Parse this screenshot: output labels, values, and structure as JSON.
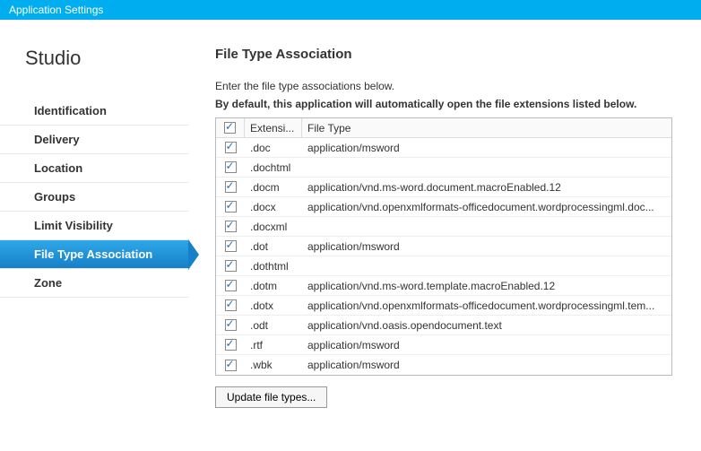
{
  "window": {
    "title": "Application Settings"
  },
  "app": {
    "name": "Studio"
  },
  "nav": {
    "items": [
      {
        "label": "Identification",
        "active": false
      },
      {
        "label": "Delivery",
        "active": false
      },
      {
        "label": "Location",
        "active": false
      },
      {
        "label": "Groups",
        "active": false
      },
      {
        "label": "Limit Visibility",
        "active": false
      },
      {
        "label": "File Type Association",
        "active": true
      },
      {
        "label": "Zone",
        "active": false
      }
    ]
  },
  "page": {
    "title": "File Type Association",
    "instruction1": "Enter the file type associations below.",
    "instruction2": "By default, this application will automatically open the file extensions listed below.",
    "columns": {
      "ext": "Extensi...",
      "filetype": "File Type"
    },
    "rows": [
      {
        "ext": ".doc",
        "ft": "application/msword",
        "checked": true
      },
      {
        "ext": ".dochtml",
        "ft": "",
        "checked": true
      },
      {
        "ext": ".docm",
        "ft": "application/vnd.ms-word.document.macroEnabled.12",
        "checked": true
      },
      {
        "ext": ".docx",
        "ft": "application/vnd.openxmlformats-officedocument.wordprocessingml.doc...",
        "checked": true
      },
      {
        "ext": ".docxml",
        "ft": "",
        "checked": true
      },
      {
        "ext": ".dot",
        "ft": "application/msword",
        "checked": true
      },
      {
        "ext": ".dothtml",
        "ft": "",
        "checked": true
      },
      {
        "ext": ".dotm",
        "ft": "application/vnd.ms-word.template.macroEnabled.12",
        "checked": true
      },
      {
        "ext": ".dotx",
        "ft": "application/vnd.openxmlformats-officedocument.wordprocessingml.tem...",
        "checked": true
      },
      {
        "ext": ".odt",
        "ft": "application/vnd.oasis.opendocument.text",
        "checked": true
      },
      {
        "ext": ".rtf",
        "ft": "application/msword",
        "checked": true
      },
      {
        "ext": ".wbk",
        "ft": "application/msword",
        "checked": true
      }
    ],
    "update_button": "Update file types..."
  }
}
